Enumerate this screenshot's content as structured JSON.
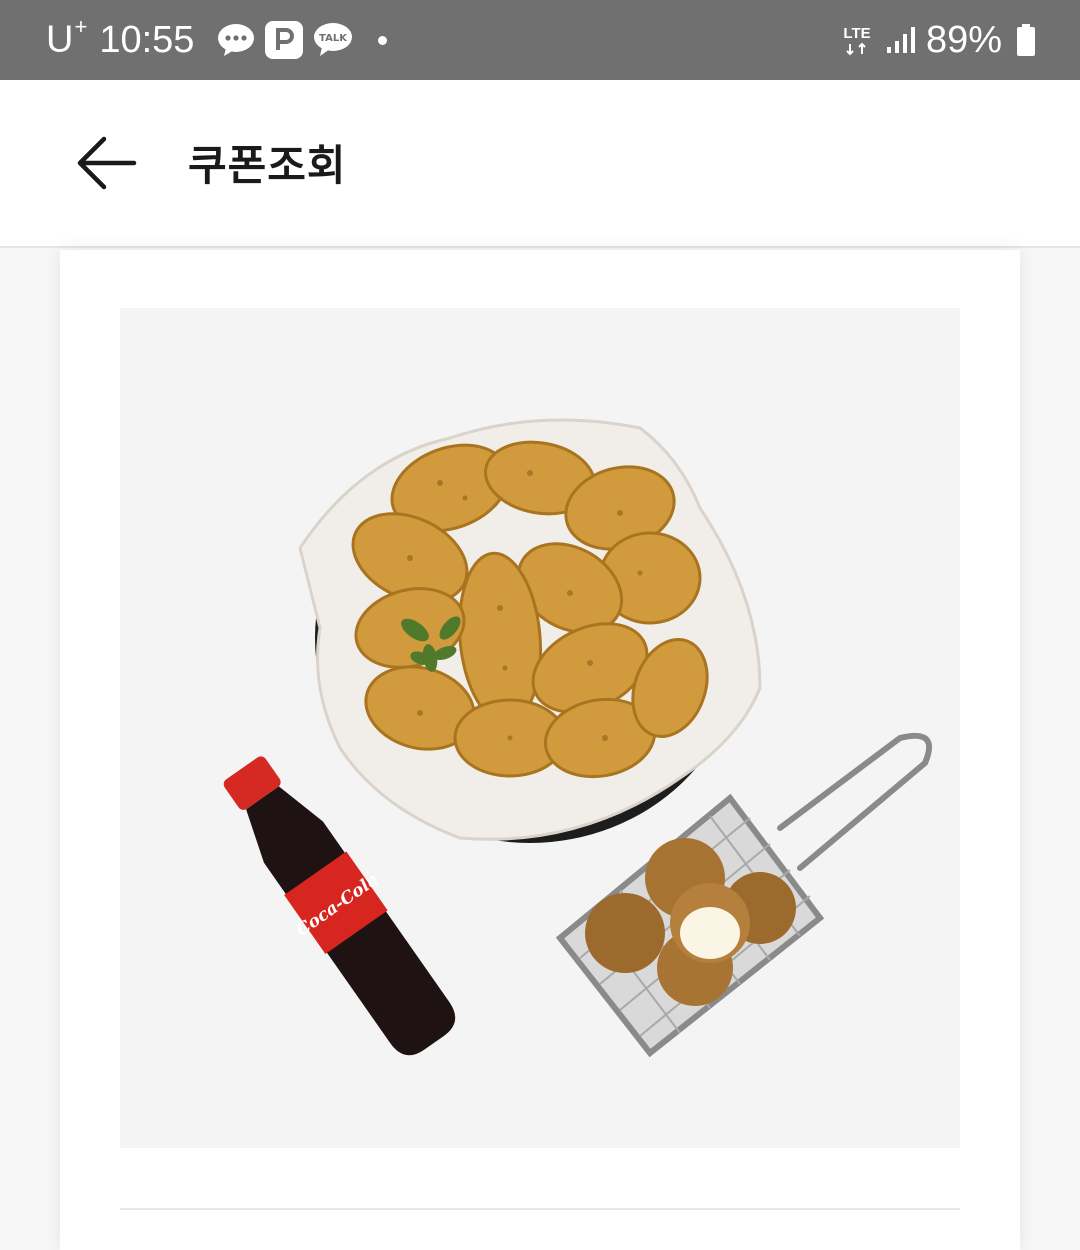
{
  "status_bar": {
    "carrier": "U",
    "carrier_sup": "+",
    "time": "10:55",
    "notification_icons": [
      "chat-bubble-icon",
      "parking-p-icon",
      "kakaotalk-icon"
    ],
    "network": "LTE",
    "battery": "89%"
  },
  "header": {
    "back_icon": "arrow-left-icon",
    "title": "쿠폰조회"
  },
  "coupon": {
    "image_description_icon": "chicken-set-product-image",
    "items": [
      "fried-chicken-basket",
      "cola-bottle",
      "cheese-balls-in-fry-basket"
    ],
    "bottle_label": "Coca-Cola"
  },
  "colors": {
    "status_bar_bg": "#707070",
    "app_bar_bg": "#ffffff",
    "page_bg": "#f7f7f7",
    "image_bg": "#f4f4f4"
  }
}
